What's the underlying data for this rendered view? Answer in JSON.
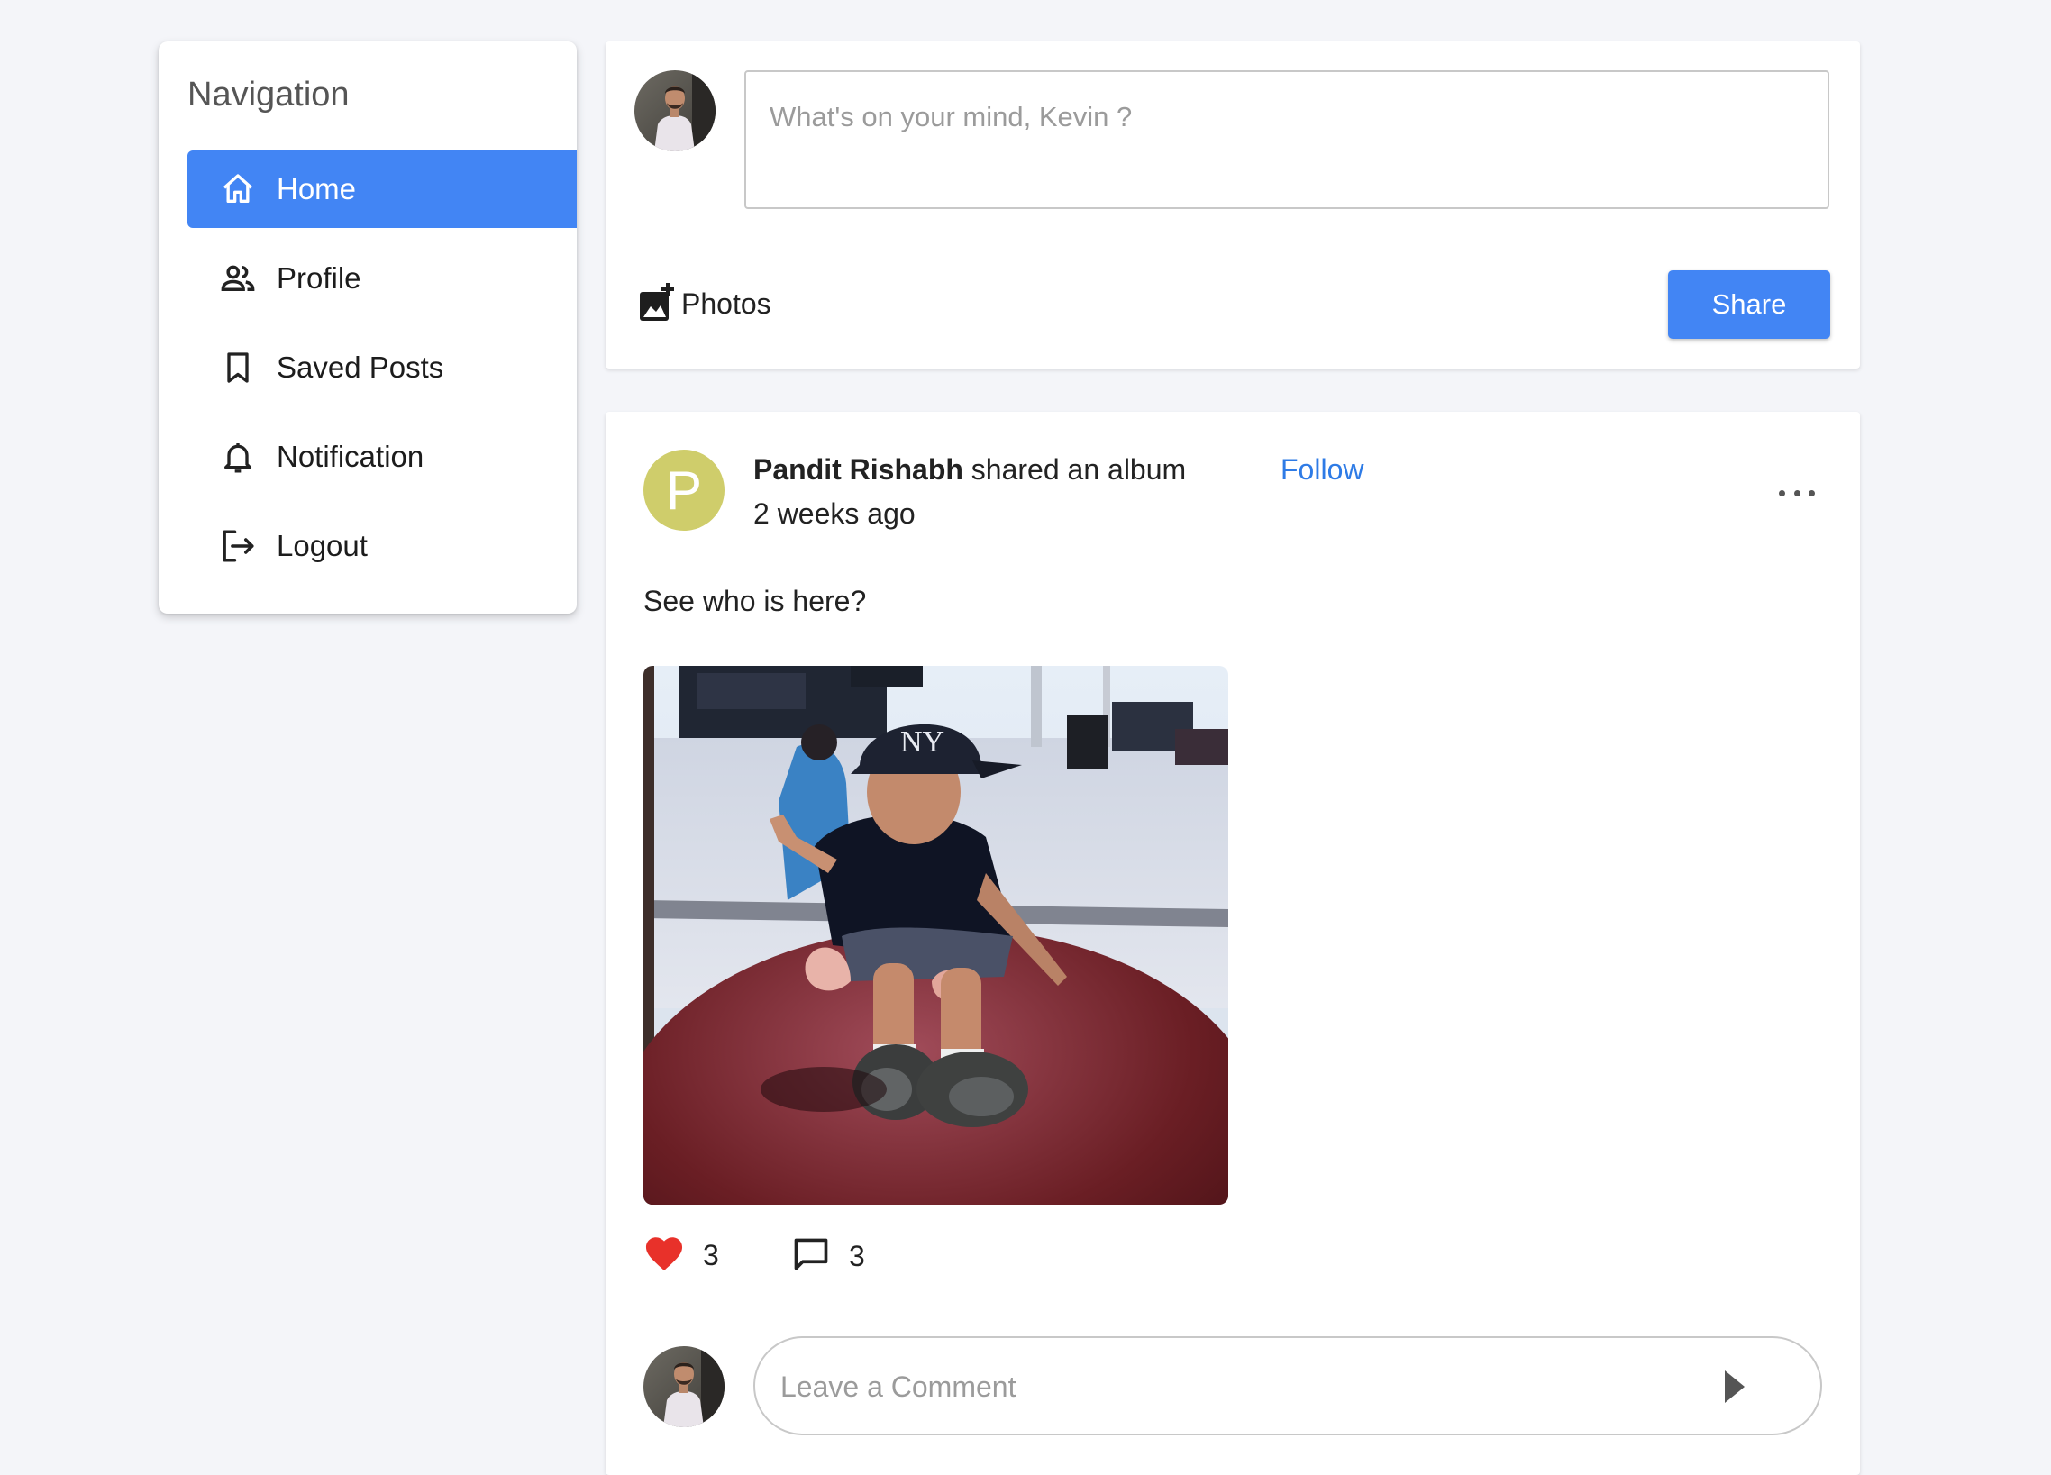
{
  "sidebar": {
    "title": "Navigation",
    "items": [
      {
        "label": "Home",
        "icon": "home-icon",
        "active": true
      },
      {
        "label": "Profile",
        "icon": "people-icon",
        "active": false
      },
      {
        "label": "Saved Posts",
        "icon": "bookmark-icon",
        "active": false
      },
      {
        "label": "Notification",
        "icon": "bell-icon",
        "active": false
      },
      {
        "label": "Logout",
        "icon": "logout-icon",
        "active": false
      }
    ]
  },
  "composer": {
    "placeholder": "What's on your mind, Kevin ?",
    "photos_label": "Photos",
    "share_label": "Share"
  },
  "post": {
    "avatar_letter": "P",
    "author": "Pandit Rishabh",
    "action": "shared an album",
    "time": "2 weeks ago",
    "follow_label": "Follow",
    "text": "See who is here?",
    "likes": "3",
    "comments": "3",
    "comment_placeholder": "Leave a Comment"
  },
  "colors": {
    "accent": "#4285f4",
    "link": "#2e7be6",
    "like": "#e8312a",
    "post_avatar": "#cfcd6b",
    "background": "#f4f5f9"
  }
}
